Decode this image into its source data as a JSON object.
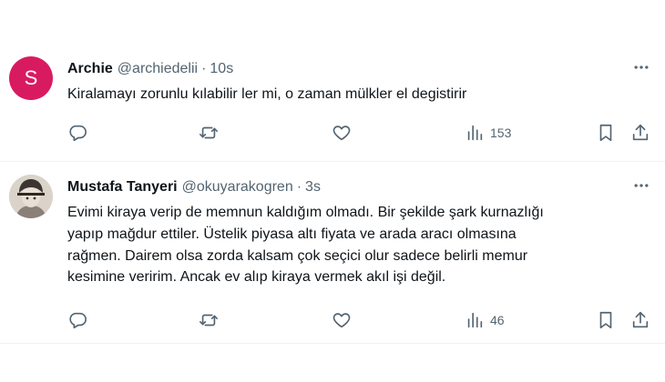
{
  "tweets": [
    {
      "avatar_letter": "S",
      "avatar_color": "#d81b60",
      "name": "Archie",
      "handle": "@archiedelii",
      "separator": "·",
      "time": "10s",
      "text": "Kiralamayı zorunlu kılabilir ler mi, o zaman mülkler el degistirir",
      "views": "153"
    },
    {
      "name": "Mustafa Tanyeri",
      "handle": "@okuyarakogren",
      "separator": "·",
      "time": "3s",
      "text_lines": [
        "Evimi kiraya verip de memnun kaldığım olmadı. Bir şekilde şark kurnazlığı",
        "yapıp mağdur ettiler. Üstelik piyasa altı fiyata ve arada aracı olmasına",
        "rağmen. Dairem olsa zorda kalsam çok seçici olur sadece belirli memur",
        "kesimine veririm. Ancak ev alıp kiraya vermek akıl işi değil."
      ],
      "views": "46"
    }
  ],
  "icons": {
    "more": "more-horizontal-icon",
    "reply": "reply-icon",
    "retweet": "retweet-icon",
    "like": "heart-icon",
    "views": "views-chart-icon",
    "bookmark": "bookmark-icon",
    "share": "share-icon"
  },
  "colors": {
    "text_primary": "#0f1419",
    "text_secondary": "#536471",
    "divider": "#eff3f4"
  }
}
